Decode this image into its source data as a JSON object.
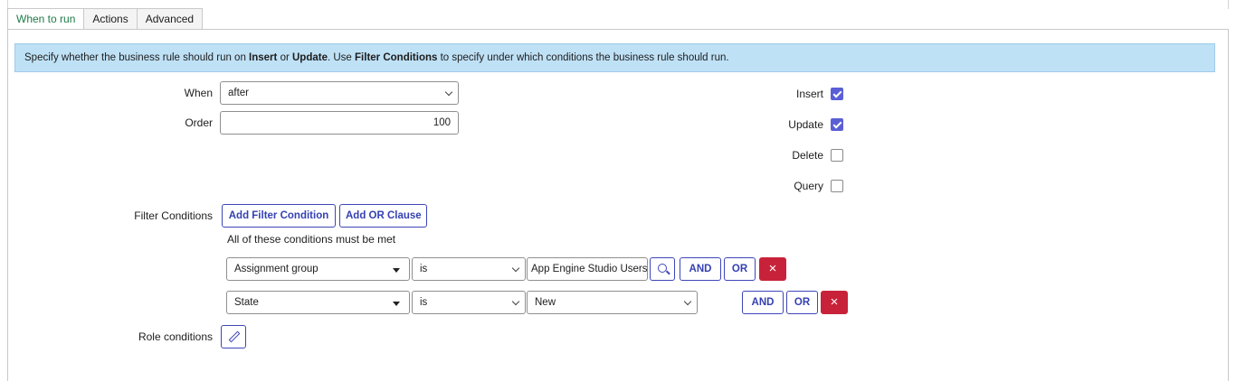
{
  "tabs": [
    {
      "label": "When to run",
      "active": true
    },
    {
      "label": "Actions",
      "active": false
    },
    {
      "label": "Advanced",
      "active": false
    }
  ],
  "info": {
    "t1": "Specify whether the business rule should run on ",
    "b1": "Insert",
    "t2": " or ",
    "b2": "Update",
    "t3": ". Use ",
    "b3": "Filter Conditions",
    "t4": " to specify under which conditions the business rule should run."
  },
  "form": {
    "when_label": "When",
    "when_value": "after",
    "order_label": "Order",
    "order_value": "100"
  },
  "checkboxes": [
    {
      "label": "Insert",
      "checked": true
    },
    {
      "label": "Update",
      "checked": true
    },
    {
      "label": "Delete",
      "checked": false
    },
    {
      "label": "Query",
      "checked": false
    }
  ],
  "filter": {
    "label": "Filter Conditions",
    "add_condition": "Add Filter Condition",
    "add_or": "Add OR Clause",
    "must_be_met": "All of these conditions must be met",
    "rows": [
      {
        "field": "Assignment group",
        "operator": "is",
        "value": "App Engine Studio Users",
        "and": "AND",
        "or": "OR",
        "delete": "×"
      },
      {
        "field": "State",
        "operator": "is",
        "value": "New",
        "and": "AND",
        "or": "OR",
        "delete": "×"
      }
    ]
  },
  "role": {
    "label": "Role conditions"
  },
  "colors": {
    "accent": "#3540b3",
    "checkbox": "#5b5fd6",
    "delete": "#c8223a",
    "info_bg": "#bfe1f6",
    "active_tab": "#1f7a4a"
  }
}
